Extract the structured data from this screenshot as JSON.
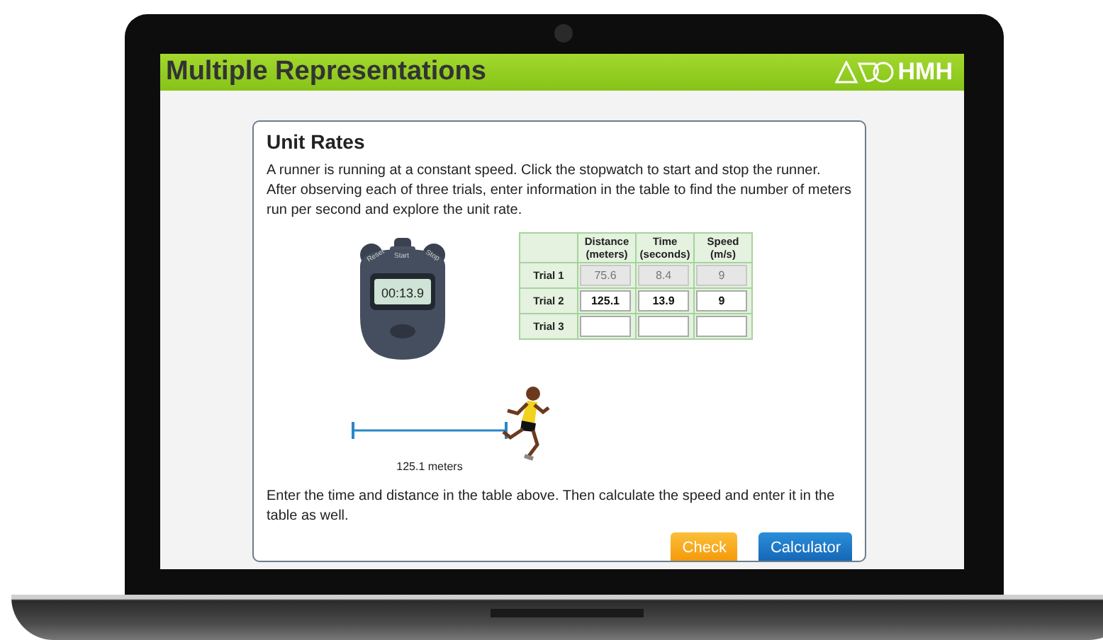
{
  "header": {
    "title": "Multiple Representations",
    "logo_text": "HMH"
  },
  "activity": {
    "title": "Unit Rates",
    "intro": "A runner is running at a constant speed. Click the stopwatch to start and stop the runner. After observing each of three trials, enter information in the table to find the number of meters run per second and explore the unit rate.",
    "stopwatch": {
      "buttons": [
        "Reset",
        "Start",
        "Stop"
      ],
      "display": "00:13.9"
    },
    "table": {
      "columns": [
        {
          "name": "Distance",
          "unit": "(meters)"
        },
        {
          "name": "Time",
          "unit": "(seconds)"
        },
        {
          "name": "Speed",
          "unit": "(m/s)"
        }
      ],
      "rows": [
        {
          "label": "Trial 1",
          "disabled": true,
          "cells": [
            "75.6",
            "8.4",
            "9"
          ]
        },
        {
          "label": "Trial 2",
          "disabled": false,
          "cells": [
            "125.1",
            "13.9",
            "9"
          ]
        },
        {
          "label": "Trial 3",
          "disabled": false
        }
      ]
    },
    "track": {
      "label": "125.1 meters"
    },
    "instructions": "Enter the time and distance in the table above. Then calculate the speed and enter it in the table as well.",
    "buttons": [
      {
        "label": "Check",
        "kind": "warning"
      },
      {
        "label": "Calculator",
        "kind": "primary"
      }
    ]
  }
}
